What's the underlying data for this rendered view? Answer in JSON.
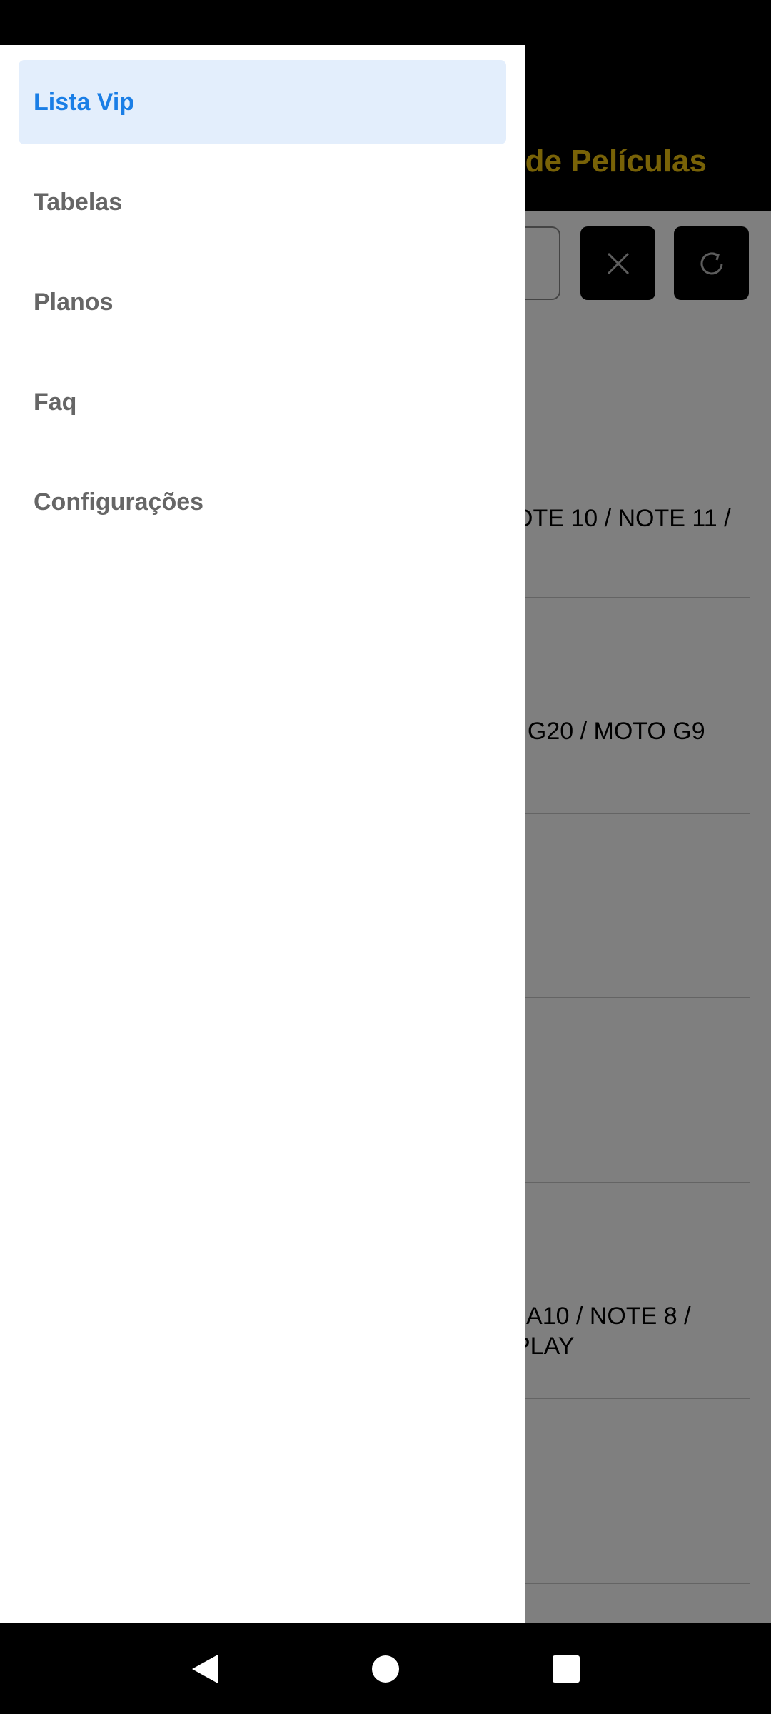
{
  "app": {
    "title": "de Películas",
    "list_items": [
      {
        "text": "OTE 10 / NOTE 11 /"
      },
      {
        "text": "/ G20 / MOTO G9"
      },
      {
        "text": ""
      },
      {
        "text": ""
      },
      {
        "text": "/ A10 / NOTE 8 / PLAY"
      },
      {
        "text": ""
      },
      {
        "text": ""
      }
    ]
  },
  "drawer": {
    "items": [
      {
        "label": "Lista Vip",
        "active": true
      },
      {
        "label": "Tabelas",
        "active": false
      },
      {
        "label": "Planos",
        "active": false
      },
      {
        "label": "Faq",
        "active": false
      },
      {
        "label": "Configurações",
        "active": false
      }
    ]
  },
  "icons": {
    "clear": "close-icon",
    "refresh": "refresh-icon",
    "back": "back-icon",
    "home": "home-icon",
    "recents": "recents-icon"
  },
  "colors": {
    "accent": "#1a7ee6",
    "active_bg": "#e3eefc",
    "title": "#f1c40f"
  }
}
